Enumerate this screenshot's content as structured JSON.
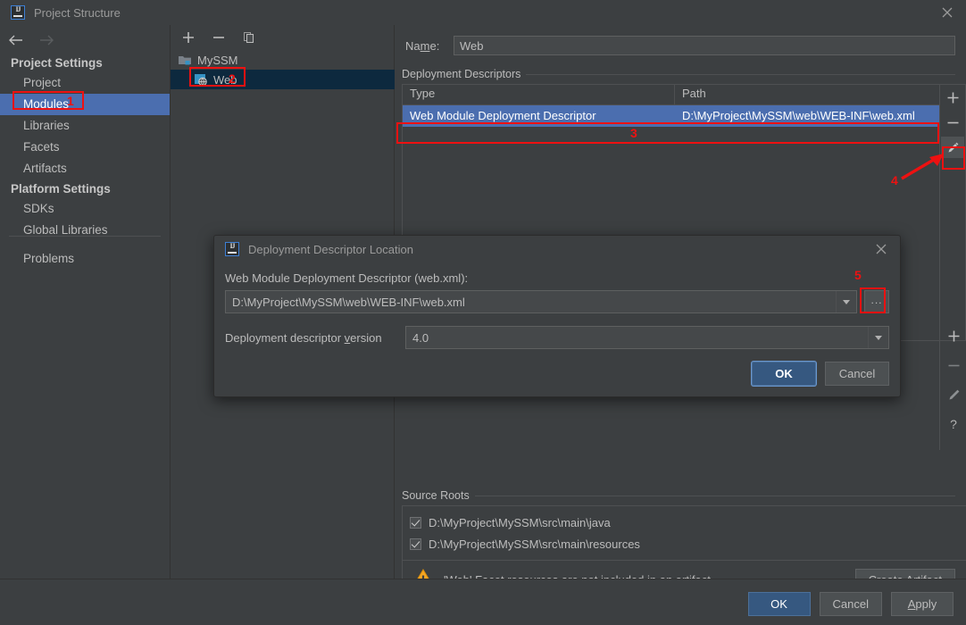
{
  "window": {
    "title": "Project Structure",
    "close_label": "close-window"
  },
  "sidebar": {
    "nav_back": "back",
    "nav_forward": "forward",
    "sections": [
      {
        "heading": "Project Settings",
        "items": [
          {
            "label": "Project",
            "selected": false
          },
          {
            "label": "Modules",
            "selected": true
          },
          {
            "label": "Libraries",
            "selected": false
          },
          {
            "label": "Facets",
            "selected": false
          },
          {
            "label": "Artifacts",
            "selected": false
          }
        ]
      },
      {
        "heading": "Platform Settings",
        "items": [
          {
            "label": "SDKs",
            "selected": false
          },
          {
            "label": "Global Libraries",
            "selected": false
          }
        ]
      }
    ],
    "problems_label": "Problems",
    "help_glyph": "?"
  },
  "tree": {
    "toolbar": [
      {
        "name": "add-module-button",
        "glyph": "+"
      },
      {
        "name": "remove-module-button",
        "glyph": "−"
      },
      {
        "name": "copy-module-button",
        "glyph": "copy"
      }
    ],
    "nodes": [
      {
        "label": "MySSM",
        "icon": "project-folder-icon",
        "selected": false,
        "depth": 0
      },
      {
        "label": "Web",
        "icon": "web-facet-icon",
        "selected": true,
        "depth": 1
      }
    ]
  },
  "main": {
    "name_label": "Name:",
    "name_value": "Web",
    "deployment_descriptors": {
      "group_title": "Deployment Descriptors",
      "columns": [
        "Type",
        "Path"
      ],
      "rows": [
        {
          "type": "Web Module Deployment Descriptor",
          "path": "D:\\MyProject\\MySSM\\web\\WEB-INF\\web.xml",
          "selected": true
        }
      ],
      "side_buttons": [
        {
          "name": "add-descriptor-button",
          "glyph": "+"
        },
        {
          "name": "remove-descriptor-button",
          "glyph": "−"
        },
        {
          "name": "edit-descriptor-button",
          "glyph": "pencil"
        }
      ]
    },
    "hidden_panel_buttons": [
      {
        "name": "add-button",
        "glyph": "+"
      },
      {
        "name": "remove-button",
        "glyph": "−"
      },
      {
        "name": "edit-button",
        "glyph": "pencil"
      },
      {
        "name": "help-button",
        "glyph": "?"
      }
    ],
    "source_roots": {
      "group_title": "Source Roots",
      "items": [
        {
          "label": "D:\\MyProject\\MySSM\\src\\main\\java",
          "checked": true
        },
        {
          "label": "D:\\MyProject\\MySSM\\src\\main\\resources",
          "checked": true
        }
      ]
    },
    "warning": {
      "icon": "warning-triangle-icon",
      "text": "'Web' Facet resources are not included in an artifact",
      "action_label": "Create Artif",
      "action_label_underline": "a",
      "action_label_tail": "ct"
    }
  },
  "footer": {
    "buttons": [
      {
        "label": "OK",
        "primary": true,
        "name": "ok-button"
      },
      {
        "label": "Cancel",
        "primary": false,
        "name": "cancel-button"
      },
      {
        "label": "Apply",
        "primary": false,
        "name": "apply-button",
        "underline": "A",
        "tail": "pply"
      }
    ]
  },
  "dialog": {
    "title": "Deployment Descriptor Location",
    "descriptor_label": "Web Module Deployment Descriptor (web.xml):",
    "descriptor_value": "D:\\MyProject\\MySSM\\web\\WEB-INF\\web.xml",
    "browse_label": "...",
    "version_label_pre": "Deployment descriptor ",
    "version_label_underline": "v",
    "version_label_post": "ersion",
    "version_value": "4.0",
    "buttons": [
      {
        "label": "OK",
        "primary": true,
        "name": "dialog-ok-button"
      },
      {
        "label": "Cancel",
        "primary": false,
        "name": "dialog-cancel-button"
      }
    ]
  },
  "annotations": {
    "color": "#ee1111",
    "markers": [
      {
        "id": "1",
        "target": "Modules sidebar item"
      },
      {
        "id": "2",
        "target": "Web module tree node"
      },
      {
        "id": "3",
        "target": "Web Module Deployment Descriptor row"
      },
      {
        "id": "4",
        "target": "Edit descriptor pencil button"
      },
      {
        "id": "5",
        "target": "Browse (...) button in dialog"
      }
    ]
  }
}
